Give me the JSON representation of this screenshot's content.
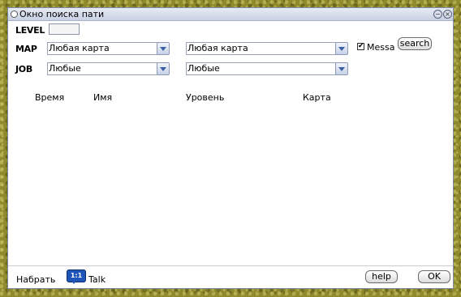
{
  "window": {
    "title": "Окно поиска пати"
  },
  "labels": {
    "level": "LEVEL",
    "map": "MAP",
    "job": "JOB"
  },
  "map_select_1": {
    "value": "Любая карта"
  },
  "map_select_2": {
    "value": "Любая карта"
  },
  "job_select_1": {
    "value": "Любые"
  },
  "job_select_2": {
    "value": "Любые"
  },
  "message_checkbox": {
    "label": "Messa",
    "checked": true
  },
  "buttons": {
    "search": "search",
    "help": "help",
    "ok": "OK"
  },
  "columns": [
    "Время",
    "Имя",
    "Уровень",
    "Карта"
  ],
  "footer": {
    "recruit": "Набрать",
    "talk_icon_text": "1:1",
    "talk": "Talk"
  },
  "colors": {
    "title_bar": "#c8d0e3",
    "background": "#8f8a2c",
    "arrow": "#3c5fa3"
  }
}
